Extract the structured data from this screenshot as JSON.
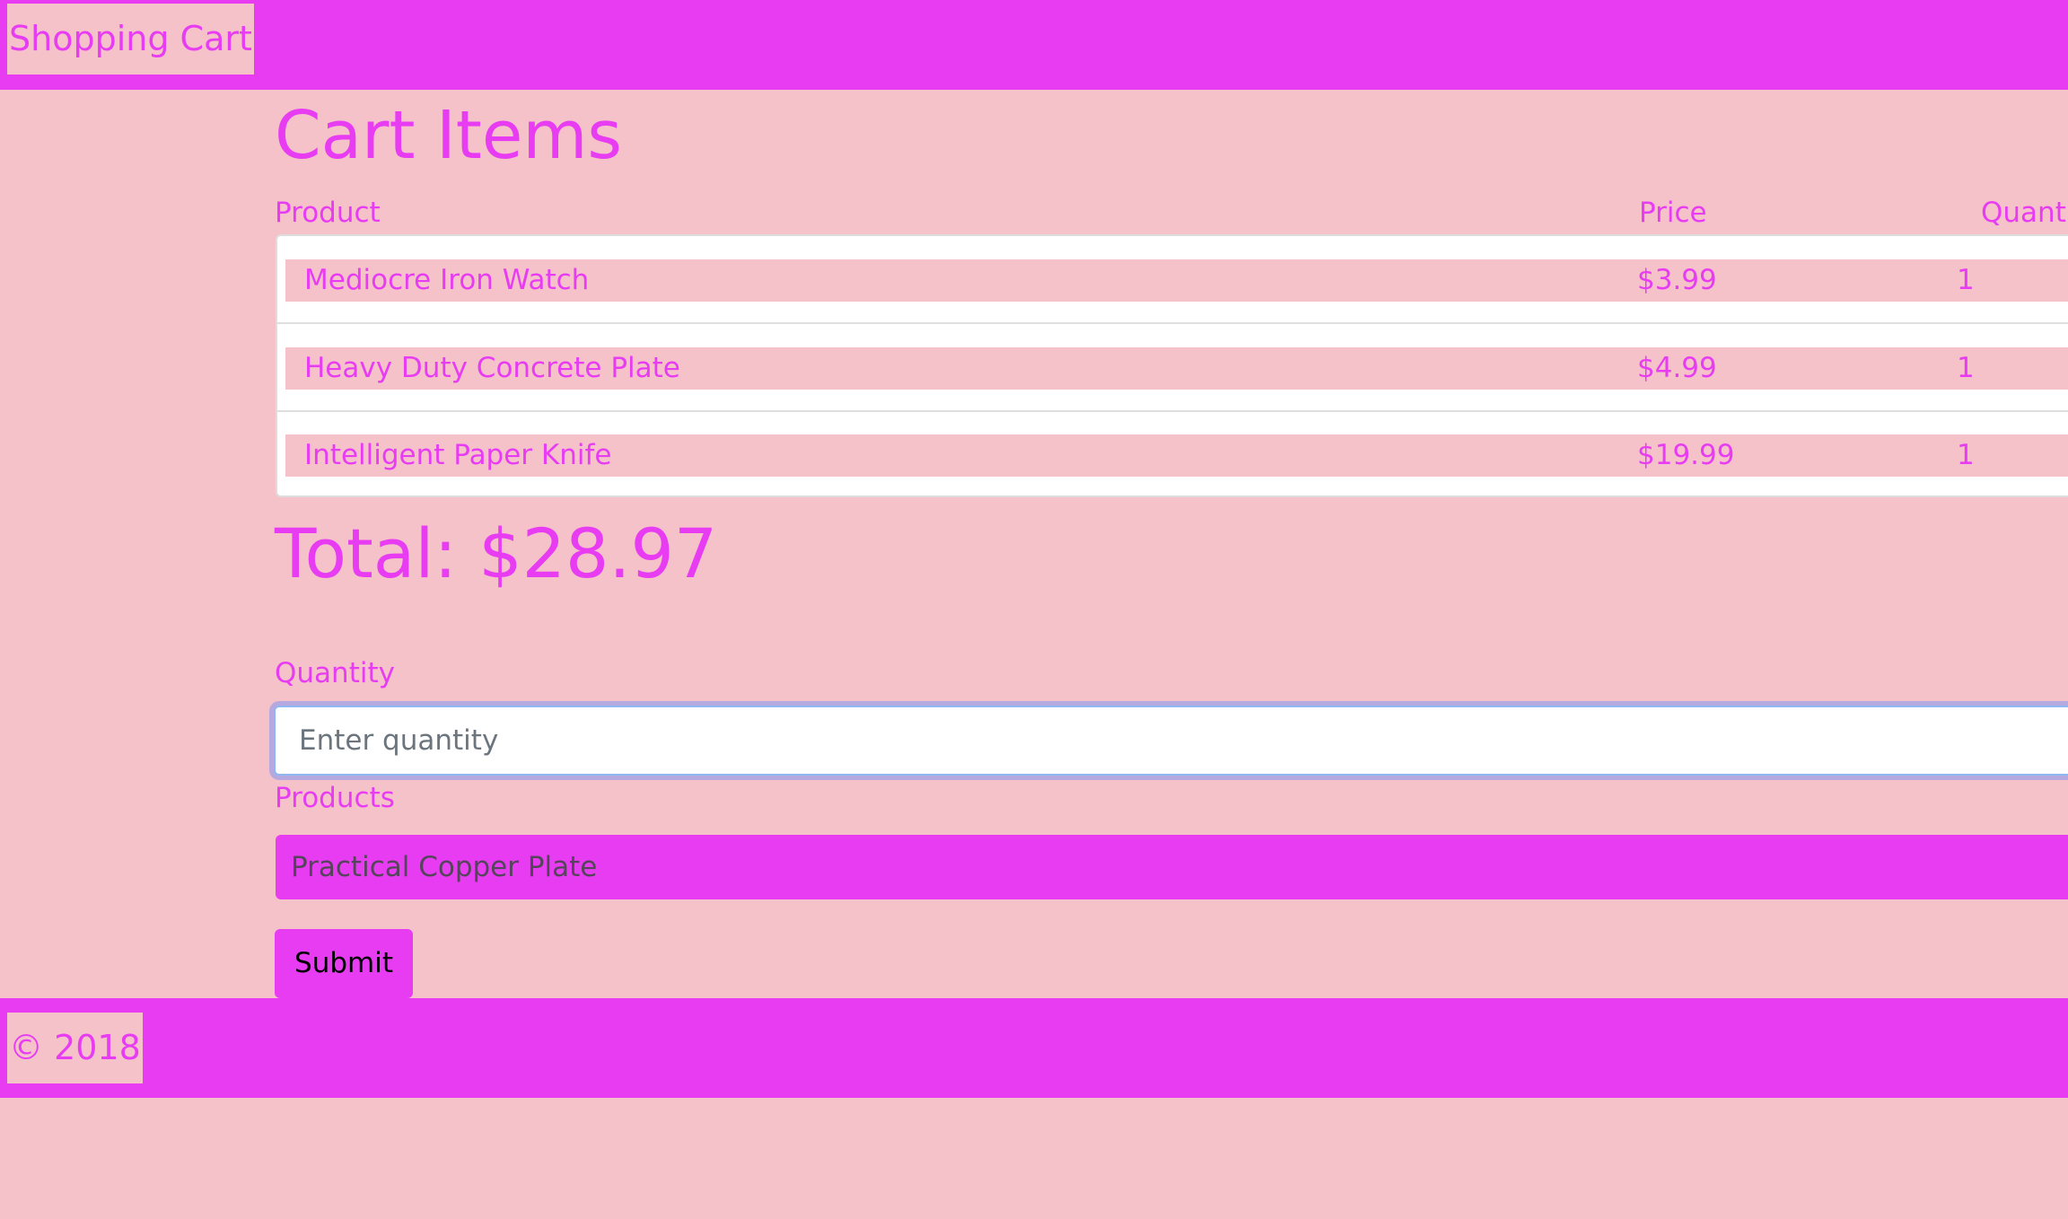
{
  "navbar": {
    "brand": "Shopping Cart"
  },
  "cart": {
    "title": "Cart Items",
    "columns": {
      "product": "Product",
      "price": "Price",
      "quantity": "Quantity"
    },
    "items": [
      {
        "name": "Mediocre Iron Watch",
        "price": "$3.99",
        "quantity": "1"
      },
      {
        "name": "Heavy Duty Concrete Plate",
        "price": "$4.99",
        "quantity": "1"
      },
      {
        "name": "Intelligent Paper Knife",
        "price": "$19.99",
        "quantity": "1"
      }
    ],
    "total": "Total: $28.97"
  },
  "form": {
    "quantity_label": "Quantity",
    "quantity_placeholder": "Enter quantity",
    "quantity_value": "",
    "products_label": "Products",
    "products_selected": "Practical Copper Plate",
    "submit_label": "Submit"
  },
  "footer": {
    "copyright": "© 2018"
  },
  "colors": {
    "accent": "#e83cf2",
    "background": "#f5c2ca",
    "focus_ring": "#8fb7f2"
  }
}
